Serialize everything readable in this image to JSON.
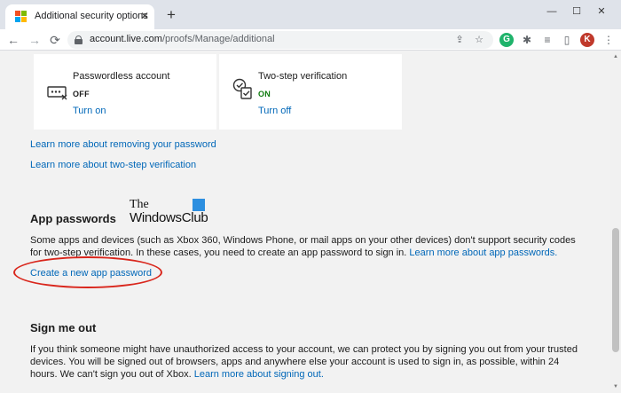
{
  "browser": {
    "tab_title": "Additional security options",
    "tab_close": "✕",
    "new_tab": "+",
    "minimize": "—",
    "maximize": "☐",
    "close": "✕",
    "back": "←",
    "forward": "→",
    "reload": "⟳",
    "url_host": "account.live.com",
    "url_path": "/proofs/Manage/additional",
    "share_icon": "⇪",
    "star_icon": "☆",
    "ext_grammarly": "G",
    "puzzle_icon": "✱",
    "reading_list_icon": "≡",
    "sidepanel_icon": "▯",
    "profile_initial": "K",
    "menu_icon": "⋮"
  },
  "cards": [
    {
      "title": "Passwordless account",
      "status": "OFF",
      "status_color": "#1b1b1b",
      "link": "Turn on",
      "icon": "password-off-icon"
    },
    {
      "title": "Two-step verification",
      "status": "ON",
      "status_color": "#107c10",
      "link": "Turn off",
      "icon": "two-step-check-icon"
    }
  ],
  "links": {
    "remove_password": "Learn more about removing your password",
    "two_step": "Learn more about two-step verification"
  },
  "app_passwords": {
    "heading": "App passwords",
    "text": "Some apps and devices (such as Xbox 360, Windows Phone, or mail apps on your other devices) don't support security codes for two-step verification. In these cases, you need to create an app password to sign in.",
    "learn_more": "Learn more about app passwords.",
    "create_link": "Create a new app password"
  },
  "watermark": {
    "line1": "The",
    "line2": "WindowsClub"
  },
  "sign_out": {
    "heading": "Sign me out",
    "text": "If you think someone might have unauthorized access to your account, we can protect you by signing you out from your trusted devices. You will be signed out of browsers, apps and anywhere else your account is used to sign in, as possible, within 24 hours. We can't sign you out of Xbox.",
    "learn_more": "Learn more about signing out."
  },
  "colors": {
    "accent_link": "#0067b8",
    "highlight": "#d9261c",
    "on_status": "#107c10"
  }
}
